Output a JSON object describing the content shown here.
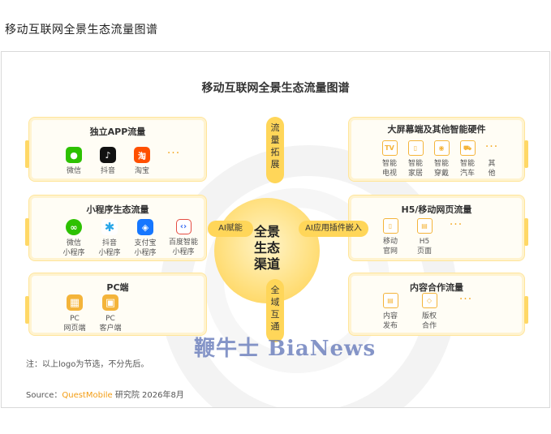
{
  "page_title": "移动互联网全景生态流量图谱",
  "diagram_title": "移动互联网全景生态流量图谱",
  "center": {
    "label": "全景\n生态\n渠道"
  },
  "connectors": {
    "top": "流\n量\n拓\n展",
    "bottom": "全\n域\n互\n通",
    "left": "AI赋能",
    "right": "AI应用插件嵌入"
  },
  "cards": {
    "app": {
      "title": "独立APP流量",
      "items": [
        {
          "label": "微信",
          "icon": "wechat-icon",
          "color": "#2dc100",
          "glyph": "●"
        },
        {
          "label": "抖音",
          "icon": "douyin-icon",
          "color": "#111111",
          "glyph": "♪"
        },
        {
          "label": "淘宝",
          "icon": "taobao-icon",
          "color": "#ff5000",
          "glyph": "淘"
        }
      ]
    },
    "mini": {
      "title": "小程序生态流量",
      "items": [
        {
          "label": "微信\n小程序",
          "icon": "wechat-miniprogram-icon",
          "color": "#2dc100",
          "glyph": "∞"
        },
        {
          "label": "抖音\n小程序",
          "icon": "douyin-miniprogram-icon",
          "color": "#2aa7e8",
          "glyph": "✱"
        },
        {
          "label": "支付宝\n小程序",
          "icon": "alipay-miniprogram-icon",
          "color": "#1677ff",
          "glyph": "◈"
        },
        {
          "label": "百度智能\n小程序",
          "icon": "baidu-miniprogram-icon",
          "color": "#3a6df0",
          "glyph": "‹›"
        }
      ]
    },
    "pc": {
      "title": "PC端",
      "items": [
        {
          "label": "PC\n网页端",
          "icon": "windows-icon",
          "color": "#f4b43a",
          "glyph": "▦"
        },
        {
          "label": "PC\n客户端",
          "icon": "pc-client-icon",
          "color": "#f4b43a",
          "glyph": "▣"
        }
      ]
    },
    "device": {
      "title": "大屏幕端及其他智能硬件",
      "items": [
        {
          "label": "智能\n电视",
          "icon": "tv-icon",
          "glyph": "TV"
        },
        {
          "label": "智能\n家居",
          "icon": "smart-home-icon",
          "glyph": "▯"
        },
        {
          "label": "智能\n穿戴",
          "icon": "wearable-icon",
          "glyph": "◉"
        },
        {
          "label": "智能\n汽车",
          "icon": "car-icon",
          "glyph": "⛟"
        },
        {
          "label": "其\n他",
          "icon": "other-icon",
          "glyph": "…"
        }
      ]
    },
    "h5": {
      "title": "H5/移动网页流量",
      "items": [
        {
          "label": "移动\n官网",
          "icon": "mobile-site-icon",
          "glyph": "▯"
        },
        {
          "label": "H5\n页面",
          "icon": "h5-page-icon",
          "glyph": "▤"
        }
      ]
    },
    "content": {
      "title": "内容合作流量",
      "items": [
        {
          "label": "内容\n发布",
          "icon": "content-publish-icon",
          "glyph": "▤"
        },
        {
          "label": "版权\n合作",
          "icon": "handshake-icon",
          "glyph": "◇"
        }
      ]
    }
  },
  "note": "注：以上logo为节选，不分先后。",
  "source": {
    "prefix": "Source：",
    "brand": "QuestMobile",
    "suffix": " 研究院 2026年8月"
  },
  "watermark": "鞭牛士 BiaNews",
  "colors": {
    "accent": "#ffd659",
    "brand": "#f39c12",
    "watermark": "#5d72b6"
  }
}
